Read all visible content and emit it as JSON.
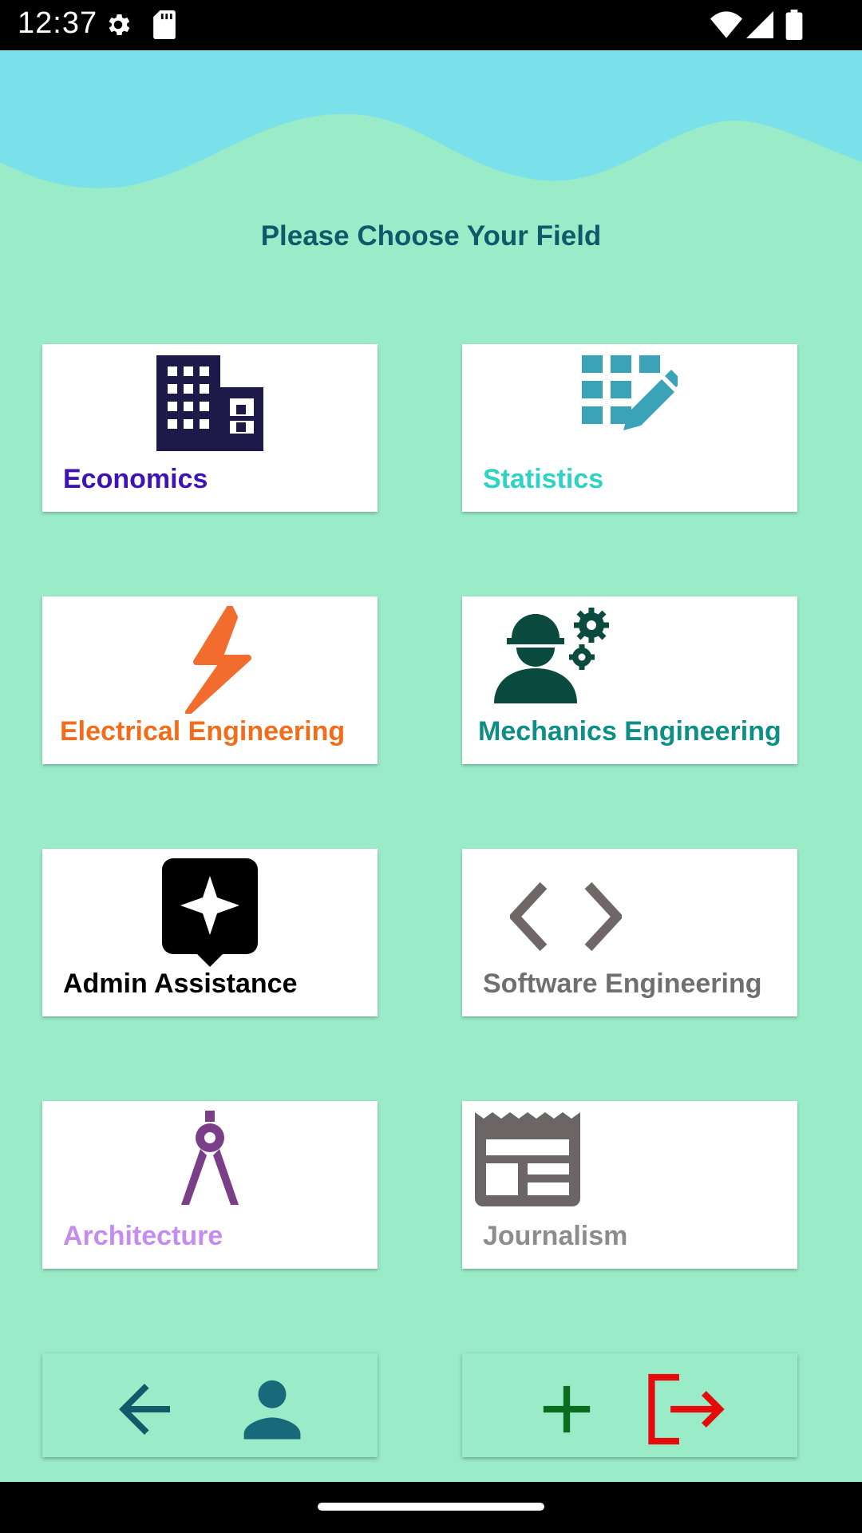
{
  "status_bar": {
    "time": "12:37",
    "icons": [
      "gear-icon",
      "sd-card-icon",
      "wifi-icon",
      "signal-icon",
      "battery-icon"
    ]
  },
  "colors": {
    "background": "#9aecc9",
    "wave": "#7ae0ea",
    "title": "#0d5a6b"
  },
  "page": {
    "title": "Please Choose Your Field"
  },
  "fields": [
    {
      "label": "Economics",
      "icon": "building-icon",
      "color": "#3f12b8"
    },
    {
      "label": "Statistics",
      "icon": "data-edit-icon",
      "color": "#2ed3c3"
    },
    {
      "label": "Electrical Engineering",
      "icon": "lightning-bolt-icon",
      "color": "#f26c1a"
    },
    {
      "label": "Mechanics Engineering",
      "icon": "engineer-gears-icon",
      "color": "#0e8f86"
    },
    {
      "label": "Admin Assistance",
      "icon": "assistant-star-icon",
      "color": "#000000"
    },
    {
      "label": "Software Engineering",
      "icon": "code-brackets-icon",
      "color": "#6f6f6f"
    },
    {
      "label": "Architecture",
      "icon": "compass-drafting-icon",
      "color": "#c58cf0"
    },
    {
      "label": "Journalism",
      "icon": "newspaper-icon",
      "color": "#8c8c8c"
    }
  ],
  "bottom_nav": {
    "left": [
      "back-arrow-icon",
      "profile-icon"
    ],
    "right": [
      "add-icon",
      "logout-icon"
    ]
  }
}
